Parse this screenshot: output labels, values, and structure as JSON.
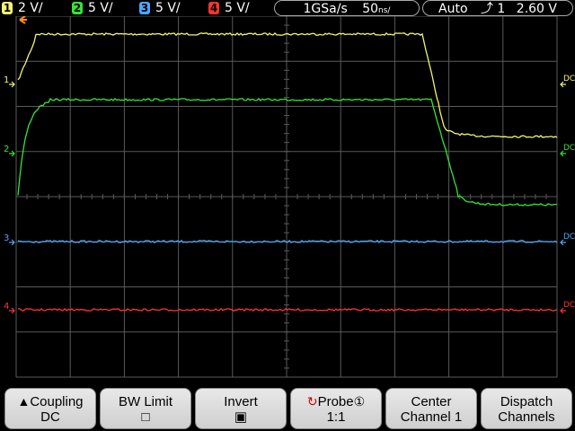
{
  "channels": [
    {
      "num": "1",
      "scale": "2 V/",
      "color": "#f5f56e"
    },
    {
      "num": "2",
      "scale": "5 V/",
      "color": "#33e633"
    },
    {
      "num": "3",
      "scale": "5 V/",
      "color": "#4da6ff"
    },
    {
      "num": "4",
      "scale": "5 V/",
      "color": "#ff3333"
    }
  ],
  "timebase": {
    "sample_rate": "1GSa/s",
    "scale_value": "50",
    "scale_unit": "ns/"
  },
  "trigger": {
    "mode": "Auto",
    "source_icon": "rising-edge-icon",
    "source": "1",
    "level": "2.60 V"
  },
  "markers": {
    "ch1": {
      "label": "1",
      "coupling": "DC"
    },
    "ch2": {
      "label": "2",
      "coupling": "DC"
    },
    "ch3": {
      "label": "3",
      "coupling": "DC"
    },
    "ch4": {
      "label": "4",
      "coupling": "DC"
    }
  },
  "softkeys": [
    {
      "line1": "Coupling",
      "line2": "DC",
      "icon": "up-arrow-icon"
    },
    {
      "line1": "BW Limit",
      "line2": "□"
    },
    {
      "line1": "Invert",
      "line2": "▣"
    },
    {
      "line1": "Probe",
      "line2": "1:1",
      "icon": "rotate-knob-icon",
      "badge": "①"
    },
    {
      "line1": "Center",
      "line2": "Channel 1"
    },
    {
      "line1": "Dispatch",
      "line2": "Channels"
    }
  ],
  "colors": {
    "grid": "#5a5a5a",
    "background": "#000000",
    "softkey_bg": "#dcdcdc",
    "trigger_marker": "#ff8c1a"
  }
}
